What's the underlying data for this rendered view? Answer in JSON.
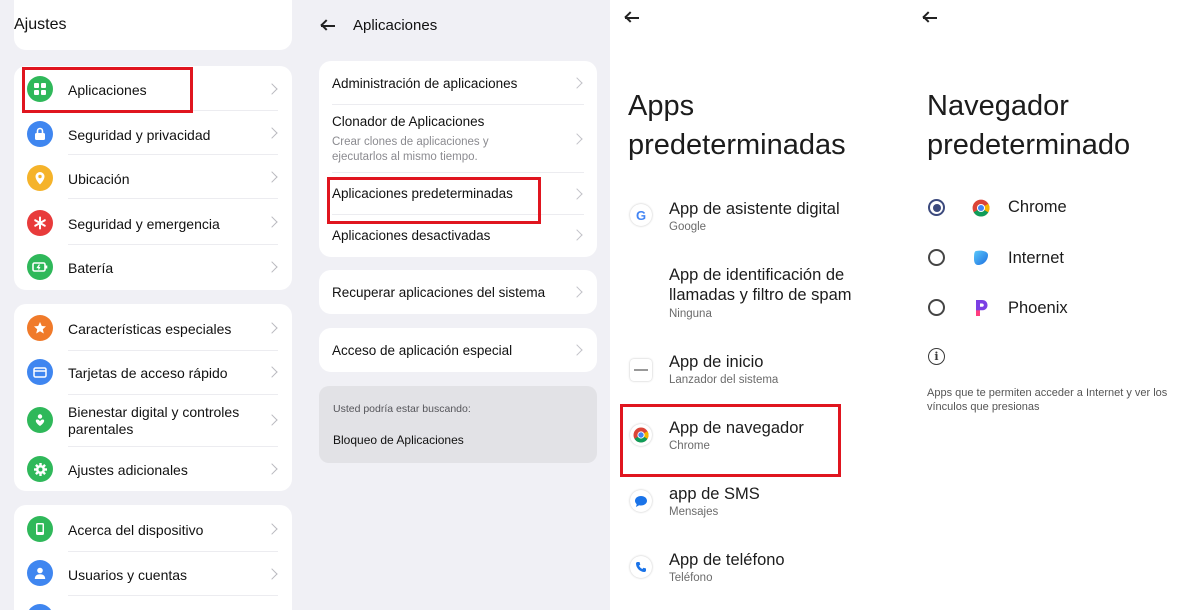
{
  "colors": {
    "highlight": "#e0151f",
    "radio_selected": "#3c4a7d"
  },
  "panel1": {
    "title": "Ajustes",
    "group1": [
      {
        "label": "Aplicaciones",
        "icon": "apps-grid-icon",
        "color": "#2fb85a"
      },
      {
        "label": "Seguridad y privacidad",
        "icon": "lock-icon",
        "color": "#3f86f0"
      },
      {
        "label": "Ubicación",
        "icon": "location-pin-icon",
        "color": "#f5b32a"
      },
      {
        "label": "Seguridad y emergencia",
        "icon": "asterisk-icon",
        "color": "#e83b3b"
      },
      {
        "label": "Batería",
        "icon": "battery-icon",
        "color": "#2fb85a"
      }
    ],
    "group2": [
      {
        "label": "Características especiales",
        "icon": "star-icon",
        "color": "#f07a2a"
      },
      {
        "label": "Tarjetas de acceso rápido",
        "icon": "card-icon",
        "color": "#3f86f0"
      },
      {
        "label": "Bienestar digital y controles parentales",
        "icon": "heart-icon",
        "color": "#2fb85a"
      },
      {
        "label": "Ajustes adicionales",
        "icon": "gear-icon",
        "color": "#2fb85a"
      }
    ],
    "group3": [
      {
        "label": "Acerca del dispositivo",
        "icon": "phone-icon",
        "color": "#2fb85a"
      },
      {
        "label": "Usuarios y cuentas",
        "icon": "user-icon",
        "color": "#3f86f0"
      }
    ]
  },
  "panel2": {
    "title": "Aplicaciones",
    "card1": [
      {
        "title": "Administración de aplicaciones",
        "subtitle": ""
      },
      {
        "title": "Clonador de Aplicaciones",
        "subtitle": "Crear clones de aplicaciones y ejecutarlos al mismo tiempo."
      },
      {
        "title": "Aplicaciones predeterminadas",
        "subtitle": ""
      },
      {
        "title": "Aplicaciones desactivadas",
        "subtitle": ""
      }
    ],
    "card2": {
      "title": "Recuperar aplicaciones del sistema"
    },
    "card3": {
      "title": "Acceso de aplicación especial"
    },
    "suggest": {
      "caption": "Usted podría estar buscando:",
      "link": "Bloqueo de Aplicaciones"
    }
  },
  "panel3": {
    "title_line1": "Apps",
    "title_line2": "predeterminadas",
    "items": [
      {
        "title": "App de asistente digital",
        "subtitle": "Google",
        "icon": "google-icon"
      },
      {
        "title": "App de identificación de llamadas y filtro de spam",
        "subtitle": "Ninguna",
        "icon": ""
      },
      {
        "title": "App de inicio",
        "subtitle": "Lanzador del sistema",
        "icon": "launcher-icon"
      },
      {
        "title": "App de navegador",
        "subtitle": "Chrome",
        "icon": "chrome-icon"
      },
      {
        "title": "app de SMS",
        "subtitle": "Mensajes",
        "icon": "messages-icon"
      },
      {
        "title": "App de teléfono",
        "subtitle": "Teléfono",
        "icon": "phone-call-icon"
      }
    ]
  },
  "panel4": {
    "title_line1": "Navegador",
    "title_line2": "predeterminado",
    "options": [
      {
        "label": "Chrome",
        "selected": true,
        "icon": "chrome-icon"
      },
      {
        "label": "Internet",
        "selected": false,
        "icon": "internet-icon"
      },
      {
        "label": "Phoenix",
        "selected": false,
        "icon": "phoenix-icon"
      }
    ],
    "description": "Apps que te permiten acceder a Internet y ver los vínculos que presionas"
  }
}
